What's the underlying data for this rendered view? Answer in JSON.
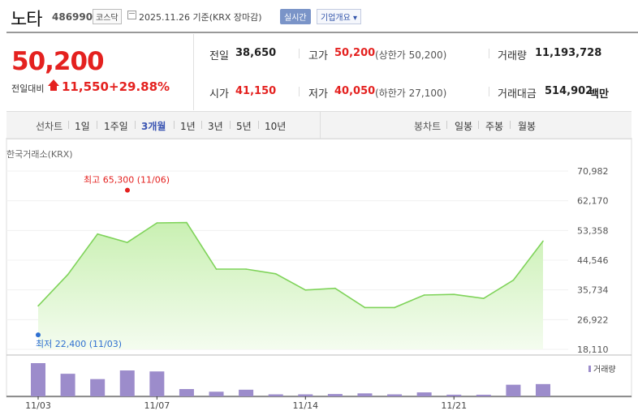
{
  "header": {
    "name": "노타",
    "code": "486990",
    "market": "코스닥",
    "date": "2025.11.26  기준(KRX 장마감)",
    "realtime": "실시간",
    "corp_info": "기업개요 ▾"
  },
  "price": {
    "current": "50,200",
    "change_label": "전일대비",
    "change": "11,550",
    "change_pct": "+29.88%"
  },
  "stats": {
    "prev_label": "전일",
    "prev": "38,650",
    "high_label": "고가",
    "high": "50,200",
    "high_note": "(상한가 50,200)",
    "volume_label": "거래량",
    "volume": "11,193,728",
    "open_label": "시가",
    "open": "41,150",
    "low_label": "저가",
    "low": "40,050",
    "low_note": "(하한가 27,100)",
    "amount_label": "거래대금",
    "amount": "514,902",
    "amount_unit": "백만"
  },
  "periods": {
    "line_label": "선차트",
    "items": [
      "1일",
      "1주일",
      "3개월",
      "1년",
      "3년",
      "5년",
      "10년"
    ],
    "active": "3개월",
    "candle_label": "봉차트",
    "candle_items": [
      "일봉",
      "주봉",
      "월봉"
    ]
  },
  "chart_data": {
    "type": "area",
    "source_label": "한국거래소(KRX)",
    "x": [
      "11/03",
      "11/04",
      "11/05",
      "11/06",
      "11/07",
      "11/10",
      "11/11",
      "11/12",
      "11/13",
      "11/14",
      "11/17",
      "11/18",
      "11/19",
      "11/20",
      "11/21",
      "11/24",
      "11/25",
      "11/26"
    ],
    "close": [
      31000,
      40300,
      52300,
      49800,
      55600,
      55700,
      41900,
      41900,
      40500,
      35700,
      36200,
      30500,
      30500,
      34200,
      34400,
      33200,
      38600,
      50200
    ],
    "volume_rel": [
      1.0,
      0.68,
      0.52,
      0.78,
      0.75,
      0.22,
      0.14,
      0.2,
      0.06,
      0.06,
      0.07,
      0.09,
      0.06,
      0.12,
      0.05,
      0.02,
      0.35,
      0.37
    ],
    "ylim": [
      18110,
      70982
    ],
    "yticks": [
      "70,982",
      "62,170",
      "53,358",
      "44,546",
      "35,734",
      "26,922",
      "18,110"
    ],
    "xticks": [
      "11/03",
      "11/07",
      "11/14",
      "11/21"
    ],
    "high_annotation": "최고 65,300 (11/06)",
    "high_value": 65300,
    "low_annotation": "최저 22,400 (11/03)",
    "low_value": 22400,
    "volume_legend": "거래량",
    "colors": {
      "line": "#7fd35a",
      "fill": "#c9f0b2",
      "bar": "#9c8ccb",
      "high": "#e4211f",
      "low": "#2f6fd1"
    }
  }
}
